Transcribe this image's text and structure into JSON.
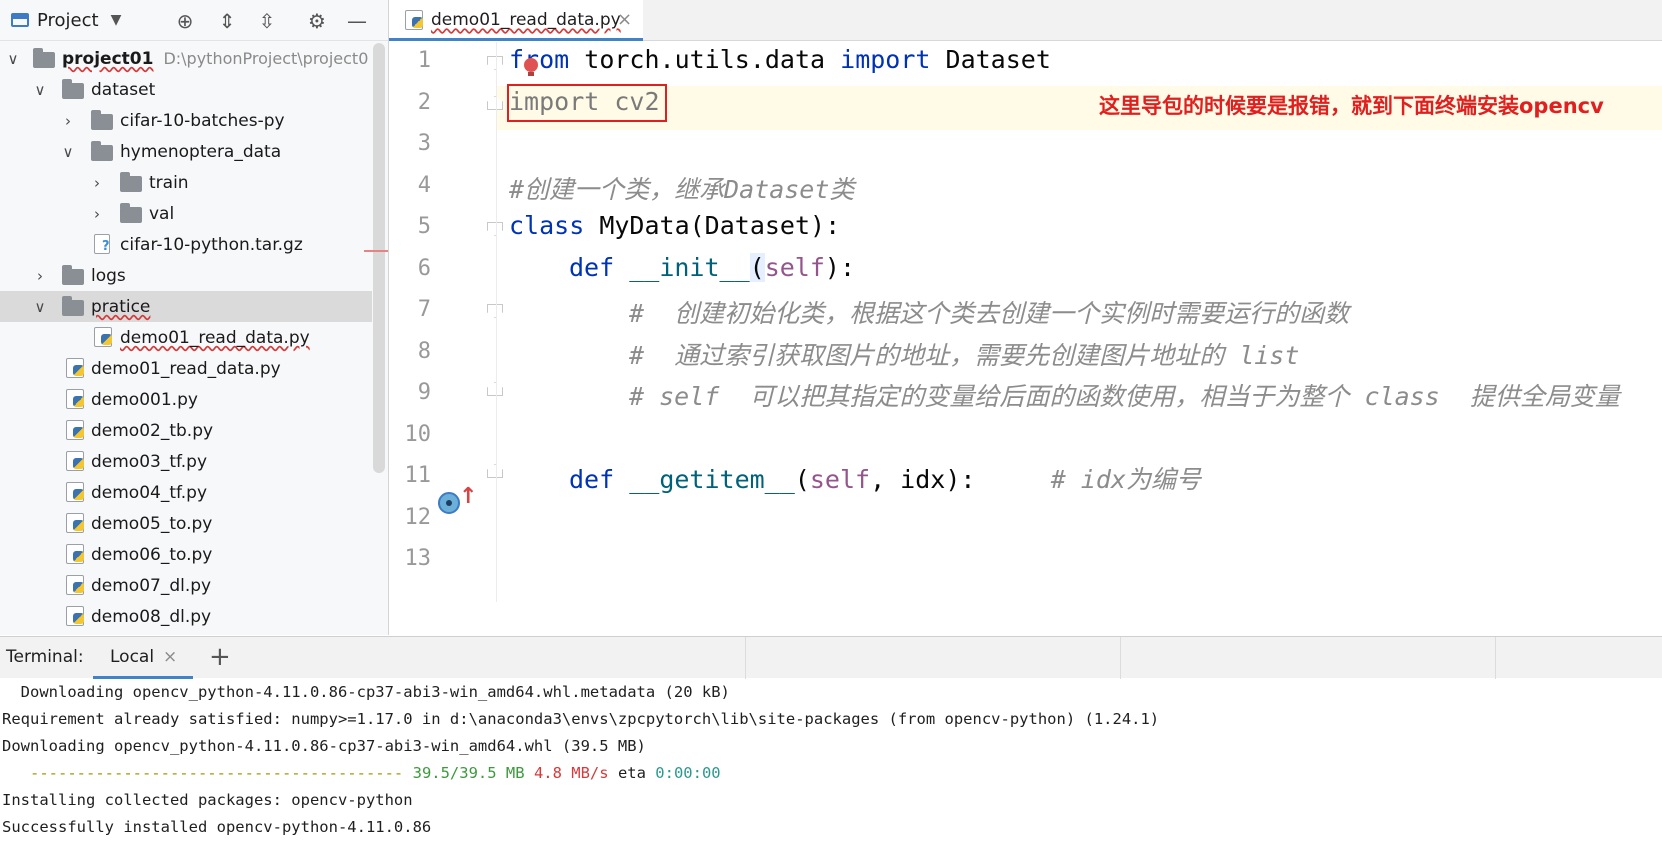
{
  "project_panel": {
    "title": "Project",
    "tree": [
      {
        "label": "project01",
        "path": "D:\\pythonProject\\project0",
        "type": "folder",
        "expanded": true
      },
      {
        "label": "dataset",
        "type": "folder",
        "expanded": true
      },
      {
        "label": "cifar-10-batches-py",
        "type": "folder",
        "expanded": false
      },
      {
        "label": "hymenoptera_data",
        "type": "folder",
        "expanded": true
      },
      {
        "label": "train",
        "type": "folder",
        "expanded": false
      },
      {
        "label": "val",
        "type": "folder",
        "expanded": false
      },
      {
        "label": "cifar-10-python.tar.gz",
        "type": "archive"
      },
      {
        "label": "logs",
        "type": "folder",
        "expanded": false
      },
      {
        "label": "pratice",
        "type": "folder",
        "expanded": true,
        "selected": true
      },
      {
        "label": "demo01_read_data.py",
        "type": "python"
      },
      {
        "label": "demo01_read_data.py",
        "type": "python"
      },
      {
        "label": "demo001.py",
        "type": "python"
      },
      {
        "label": "demo02_tb.py",
        "type": "python"
      },
      {
        "label": "demo03_tf.py",
        "type": "python"
      },
      {
        "label": "demo04_tf.py",
        "type": "python"
      },
      {
        "label": "demo05_to.py",
        "type": "python"
      },
      {
        "label": "demo06_to.py",
        "type": "python"
      },
      {
        "label": "demo07_dl.py",
        "type": "python"
      },
      {
        "label": "demo08_dl.py",
        "type": "python"
      }
    ],
    "toolbar_icons": [
      "locate-icon",
      "expand-all-icon",
      "collapse-all-icon",
      "gear-icon",
      "minimize-icon"
    ]
  },
  "editor": {
    "tab_label": "demo01_read_data.py",
    "tab_close": "×",
    "line_numbers": [
      "1",
      "2",
      "3",
      "4",
      "5",
      "6",
      "7",
      "8",
      "9",
      "10",
      "11",
      "12",
      "13"
    ],
    "lines": {
      "l1": {
        "kw1": "from",
        "mod": " torch.utils.data ",
        "kw2": "import",
        "name": " Dataset"
      },
      "l2": {
        "text": "import cv2"
      },
      "l4": {
        "comment": "#创建一个类，继承Dataset类"
      },
      "l5": {
        "kw": "class",
        "rest": " MyData(Dataset):"
      },
      "l6": {
        "kw": "def",
        "fn": "__init__",
        "open": "(",
        "self": "self",
        "close": "):"
      },
      "l7": {
        "comment": "#  创建初始化类，根据这个类去创建一个实例时需要运行的函数"
      },
      "l8": {
        "comment": "#  通过索引获取图片的地址，需要先创建图片地址的 list"
      },
      "l9": {
        "comment": "# self  可以把其指定的变量给后面的函数使用，相当于为整个 class  提供全局变量"
      },
      "l11": {
        "kw": "def",
        "fn": "__getitem__",
        "open": "(",
        "self": "self",
        "rest": ", idx):",
        "comment": "# idx为编号"
      }
    },
    "annotation": "这里导包的时候要是报错，就到下面终端安装opencv"
  },
  "terminal": {
    "title": "Terminal:",
    "tab_label": "Local",
    "tab_close": "×",
    "add_label": "+",
    "lines": {
      "t1": "  Downloading opencv_python-4.11.0.86-cp37-abi3-win_amd64.whl.metadata (20 kB)",
      "t2": "Requirement already satisfied: numpy>=1.17.0 in d:\\anaconda3\\envs\\zpcpytorch\\lib\\site-packages (from opencv-python) (1.24.1)",
      "t3": "Downloading opencv_python-4.11.0.86-cp37-abi3-win_amd64.whl (39.5 MB)",
      "t4_bar": "   ---------------------------------------- ",
      "t4_size": "39.5/39.5 MB",
      "t4_speed": "4.8 MB/s",
      "t4_eta_label": "eta",
      "t4_eta": "0:00:00",
      "t5": "Installing collected packages: opencv-python",
      "t6": "Successfully installed opencv-python-4.11.0.86"
    }
  },
  "colors": {
    "keyword": "#0033b3",
    "function": "#00627a",
    "self": "#94558d",
    "comment": "#8c8c8c",
    "annotation": "#e02020",
    "accent": "#4083c9"
  }
}
